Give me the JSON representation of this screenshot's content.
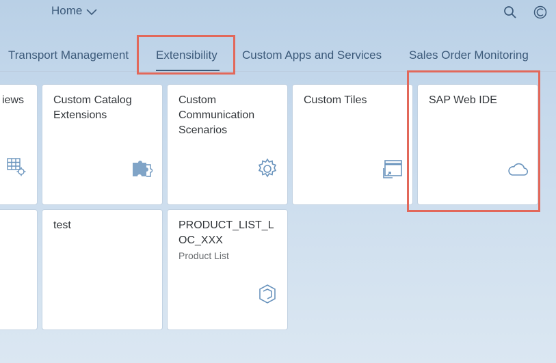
{
  "shell": {
    "home_label": "Home",
    "icons": {
      "search": "search-icon",
      "profile": "user-profile-icon",
      "chevron": "chevron-down-icon"
    }
  },
  "tabs": [
    {
      "label": "Transport Management"
    },
    {
      "label": "Extensibility",
      "selected": true
    },
    {
      "label": "Custom Apps and Services"
    },
    {
      "label": "Sales Order Monitoring"
    }
  ],
  "tiles": [
    {
      "title": "iews",
      "icon": "table-gear-icon"
    },
    {
      "title": "Custom Catalog Extensions",
      "icon": "puzzle-icon"
    },
    {
      "title": "Custom Communication Scenarios",
      "icon": "gear-icon"
    },
    {
      "title": "Custom Tiles",
      "icon": "tile-launch-icon"
    },
    {
      "title": "SAP Web IDE",
      "icon": "cloud-icon"
    },
    {
      "title": ""
    },
    {
      "title": "test"
    },
    {
      "title": "PRODUCT_LIST_LOC_XXX",
      "subtitle": "Product List",
      "icon": "product-cube-icon"
    }
  ],
  "colors": {
    "accent": "#3c5a7a",
    "icon": "#6a94bd",
    "highlight": "#e2685a",
    "tile_bg": "#ffffff"
  }
}
